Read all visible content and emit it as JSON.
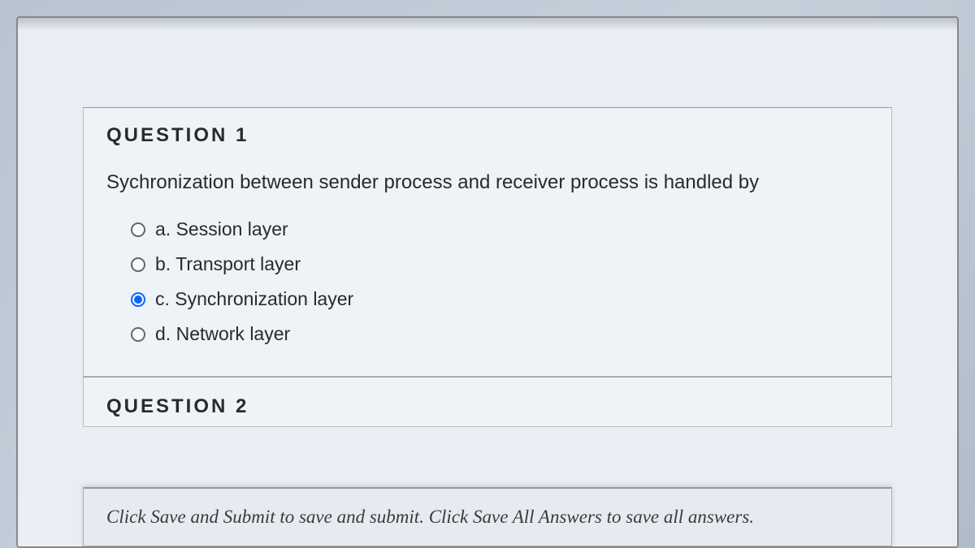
{
  "question1": {
    "title": "QUESTION 1",
    "prompt": "Sychronization between sender process and receiver process is handled by",
    "options": [
      {
        "letter": "a.",
        "text": "Session layer",
        "selected": false
      },
      {
        "letter": "b.",
        "text": "Transport layer",
        "selected": false
      },
      {
        "letter": "c.",
        "text": "Synchronization layer",
        "selected": true
      },
      {
        "letter": "d.",
        "text": "Network layer",
        "selected": false
      }
    ]
  },
  "question2": {
    "title": "QUESTION 2"
  },
  "footer": {
    "hint": "Click Save and Submit to save and submit. Click Save All Answers to save all answers."
  }
}
